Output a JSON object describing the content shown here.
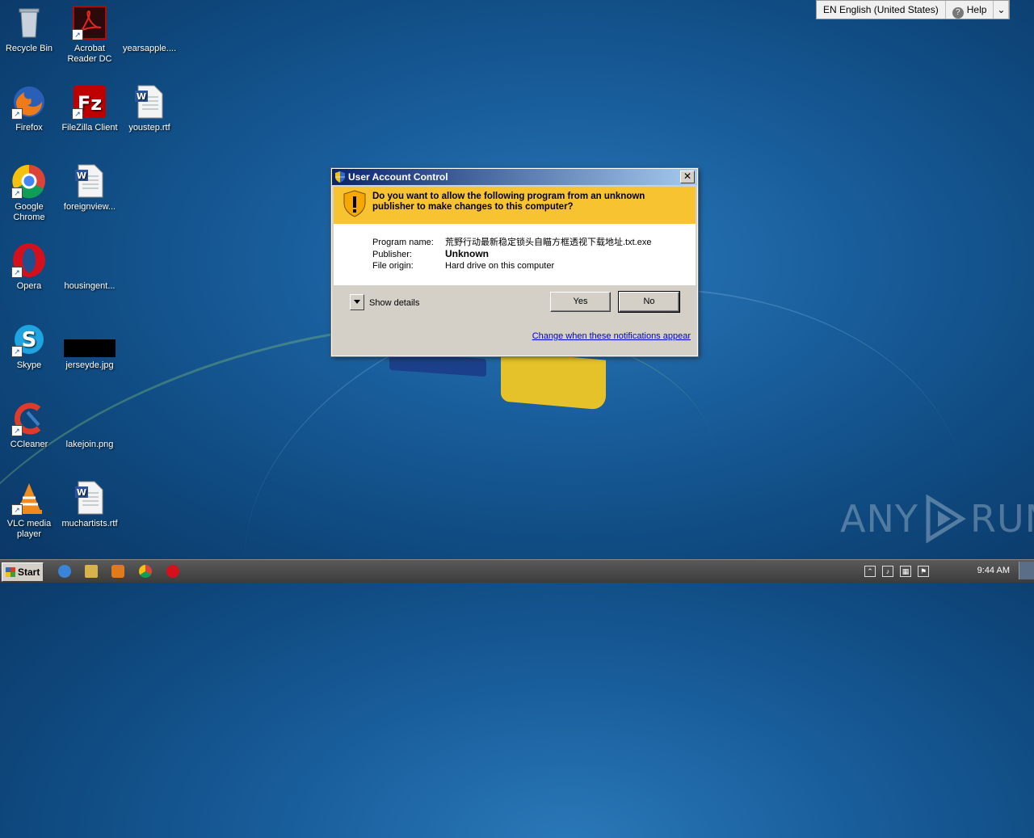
{
  "desktop": {
    "icons": [
      {
        "label": "Recycle Bin"
      },
      {
        "label": "Acrobat Reader DC"
      },
      {
        "label": "yearsapple...."
      },
      {
        "label": "Firefox"
      },
      {
        "label": "FileZilla Client"
      },
      {
        "label": "youstep.rtf"
      },
      {
        "label": "Google Chrome"
      },
      {
        "label": "foreignview..."
      },
      {
        "label": "Opera"
      },
      {
        "label": "housingent..."
      },
      {
        "label": "Skype"
      },
      {
        "label": "jerseyde.jpg"
      },
      {
        "label": "CCleaner"
      },
      {
        "label": "lakejoin.png"
      },
      {
        "label": "VLC media player"
      },
      {
        "label": "muchartists.rtf"
      }
    ]
  },
  "langbar": {
    "language": "EN English (United States)",
    "help": "Help"
  },
  "dialog": {
    "title": "User Account Control",
    "close_glyph": "✕",
    "question": "Do you want to allow the following program from an unknown publisher to make changes to this computer?",
    "program_name_label": "Program name:",
    "program_name": "荒野行动最新稳定锁头自瞄方框透视下载地址.txt.exe",
    "publisher_label": "Publisher:",
    "publisher": "Unknown",
    "file_origin_label": "File origin:",
    "file_origin": "Hard drive on this computer",
    "show_details": "Show details",
    "yes": "Yes",
    "no": "No",
    "change_link": "Change when these notifications appear"
  },
  "taskbar": {
    "start": "Start",
    "clock": "9:44 AM"
  },
  "watermark": {
    "left": "ANY",
    "right": "RUN"
  }
}
